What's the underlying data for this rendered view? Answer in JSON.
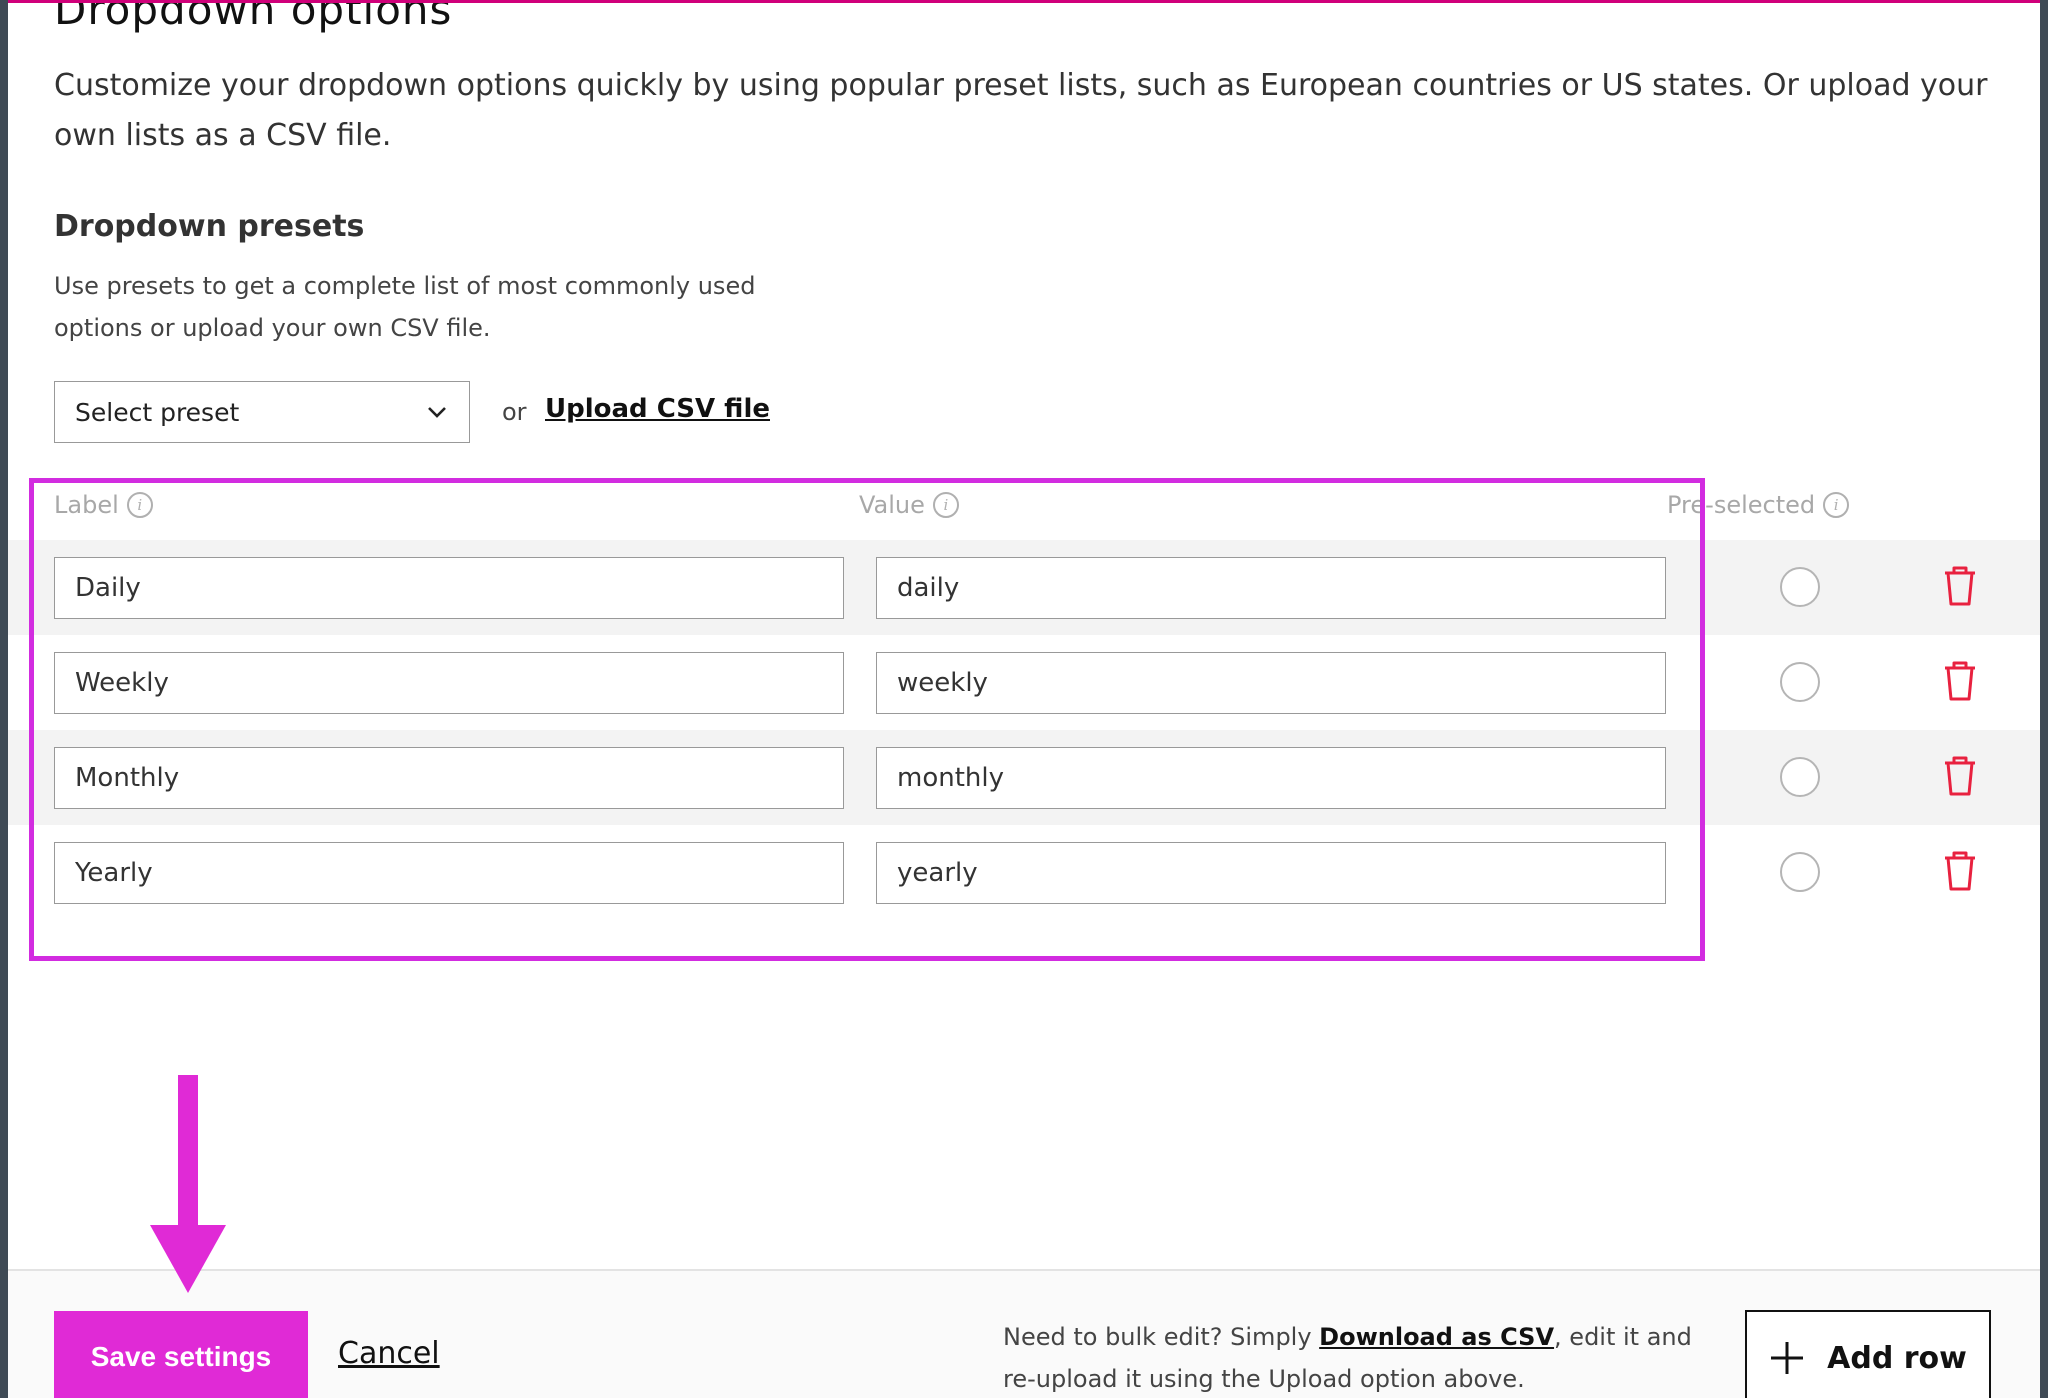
{
  "modal": {
    "title": "Dropdown options",
    "description": "Customize your dropdown options quickly by using popular preset lists, such as European countries or US states. Or upload your own lists as a CSV file."
  },
  "presets": {
    "title": "Dropdown presets",
    "description": "Use presets to get a complete list of most commonly used options or upload your own CSV file.",
    "select_value": "Select preset",
    "or_text": "or",
    "upload_link": "Upload CSV file"
  },
  "table": {
    "headers": {
      "label": "Label",
      "value": "Value",
      "preselected": "Pre-selected"
    },
    "rows": [
      {
        "label": "Daily",
        "value": "daily"
      },
      {
        "label": "Weekly",
        "value": "weekly"
      },
      {
        "label": "Monthly",
        "value": "monthly"
      },
      {
        "label": "Yearly",
        "value": "yearly"
      }
    ]
  },
  "footer": {
    "save_label": "Save settings",
    "cancel_label": "Cancel",
    "bulk_prefix": "Need to bulk edit? Simply ",
    "bulk_link": "Download as CSV",
    "bulk_suffix": ", edit it and re-upload it using the Upload option above.",
    "add_row_label": "Add row"
  },
  "colors": {
    "accent": "#e02ad6",
    "highlight": "#d22ce0",
    "delete": "#e8213f"
  }
}
